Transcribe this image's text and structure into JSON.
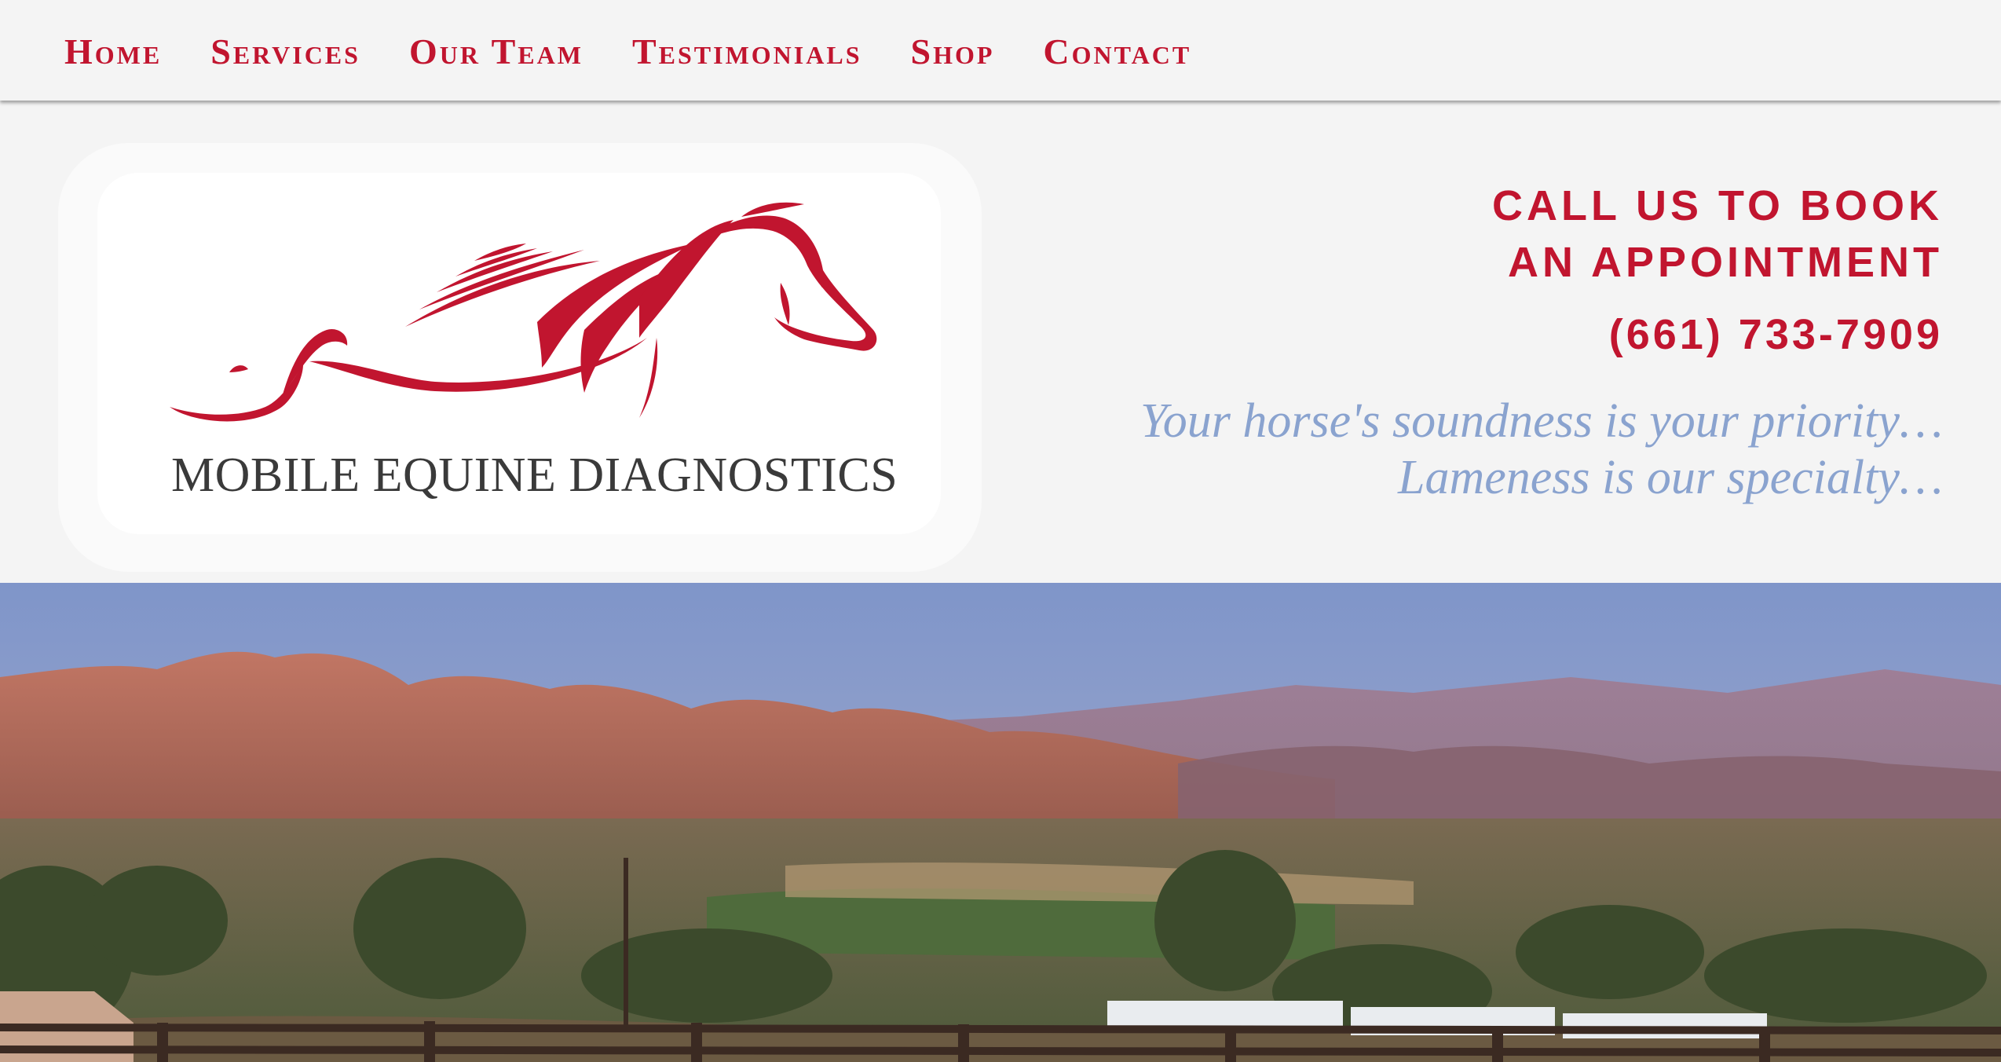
{
  "nav": {
    "items": [
      "Home",
      "Services",
      "Our Team",
      "Testimonials",
      "Shop",
      "Contact"
    ]
  },
  "logo": {
    "text": "MOBILE EQUINE DIAGNOSTICS",
    "icon": "running-horse-logo"
  },
  "cta": {
    "line1": "CALL US TO BOOK",
    "line2": "AN APPOINTMENT",
    "phone": "(661) 733-7909"
  },
  "tagline": {
    "line1": "Your horse's soundness is your priority…",
    "line2": "Lameness is our specialty…"
  },
  "hero": {
    "image": "mountain-valley-landscape"
  },
  "colors": {
    "brand_red": "#c1152f",
    "tagline_blue": "#8aa3cf",
    "background": "#f4f4f4"
  }
}
